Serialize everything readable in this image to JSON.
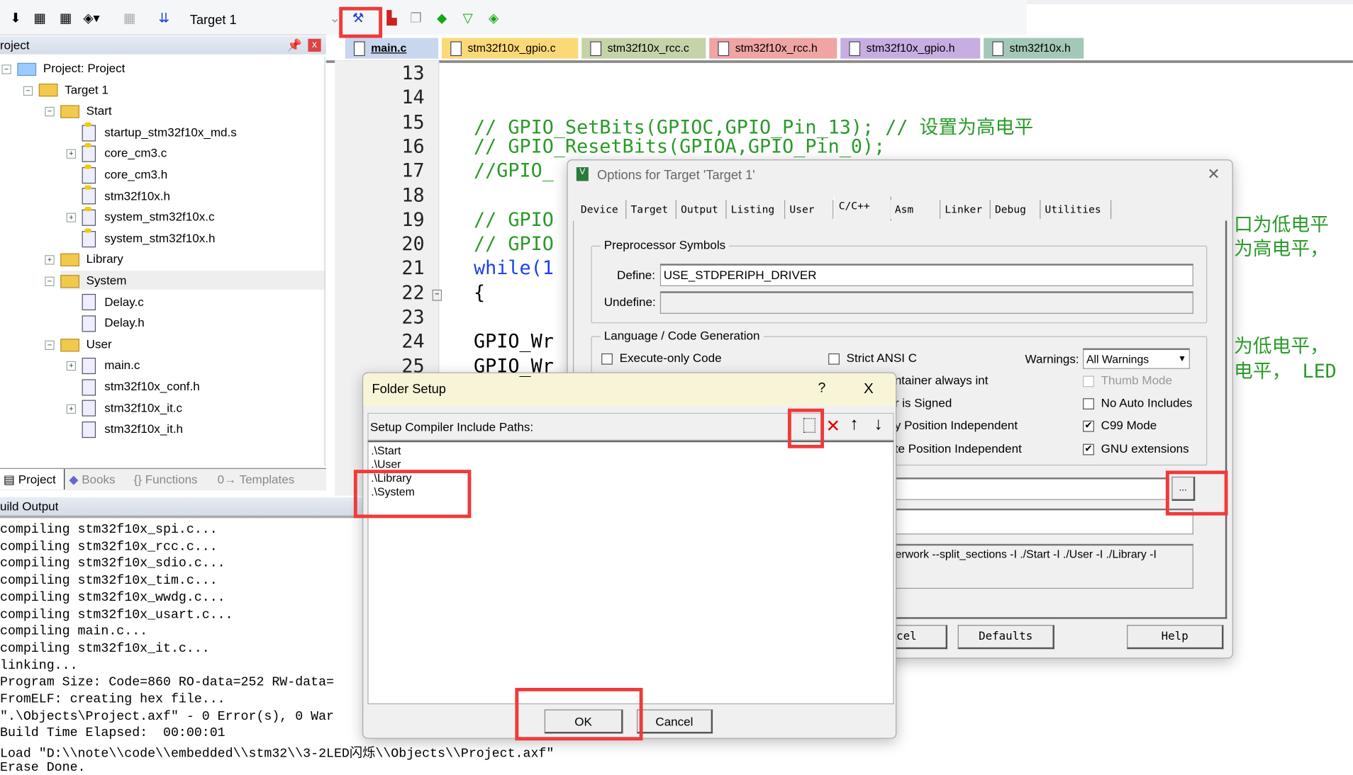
{
  "toolbar": {
    "target": "Target 1",
    "icons": [
      "translate-icon",
      "build-icon",
      "rebuild-icon",
      "batch-build-icon",
      "stop-build-icon",
      "download-icon",
      "target-options-icon",
      "file-extensions-icon",
      "manage-multi-project-icon",
      "select-packs-icon",
      "manage-run-time-icon",
      "pack-installer-icon"
    ]
  },
  "project_panel": {
    "title": "roject",
    "tree": [
      {
        "label": "Project: Project",
        "level": 0,
        "icon": "project-icon",
        "expander": "-"
      },
      {
        "label": "Target 1",
        "level": 1,
        "icon": "target-folder-icon",
        "expander": "-"
      },
      {
        "label": "Start",
        "level": 2,
        "icon": "folder-open-icon",
        "expander": "-"
      },
      {
        "label": "startup_stm32f10x_md.s",
        "level": 3,
        "icon": "key-file-icon",
        "expander": ""
      },
      {
        "label": "core_cm3.c",
        "level": 3,
        "icon": "key-file-icon",
        "expander": "+"
      },
      {
        "label": "core_cm3.h",
        "level": 3,
        "icon": "key-file-icon",
        "expander": ""
      },
      {
        "label": "stm32f10x.h",
        "level": 3,
        "icon": "key-file-icon",
        "expander": ""
      },
      {
        "label": "system_stm32f10x.c",
        "level": 3,
        "icon": "key-file-icon",
        "expander": "+"
      },
      {
        "label": "system_stm32f10x.h",
        "level": 3,
        "icon": "key-file-icon",
        "expander": ""
      },
      {
        "label": "Library",
        "level": 2,
        "icon": "folder-icon",
        "expander": "+"
      },
      {
        "label": "System",
        "level": 2,
        "icon": "folder-open-icon",
        "expander": "-",
        "selected": true
      },
      {
        "label": "Delay.c",
        "level": 3,
        "icon": "file-icon",
        "expander": ""
      },
      {
        "label": "Delay.h",
        "level": 3,
        "icon": "file-icon",
        "expander": ""
      },
      {
        "label": "User",
        "level": 2,
        "icon": "folder-open-icon",
        "expander": "-"
      },
      {
        "label": "main.c",
        "level": 3,
        "icon": "file-icon",
        "expander": "+"
      },
      {
        "label": "stm32f10x_conf.h",
        "level": 3,
        "icon": "file-icon",
        "expander": ""
      },
      {
        "label": "stm32f10x_it.c",
        "level": 3,
        "icon": "file-icon",
        "expander": "+"
      },
      {
        "label": "stm32f10x_it.h",
        "level": 3,
        "icon": "file-icon",
        "expander": ""
      }
    ],
    "tabs": [
      "Project",
      "Books",
      "{} Functions",
      "0→ Templates"
    ]
  },
  "editor": {
    "tabs": [
      {
        "label": "main.c",
        "color": "#c9d7ee",
        "active": true
      },
      {
        "label": "stm32f10x_gpio.c",
        "color": "#fcd977"
      },
      {
        "label": "stm32f10x_rcc.c",
        "color": "#c5d3a8"
      },
      {
        "label": "stm32f10x_rcc.h",
        "color": "#f0a4a4"
      },
      {
        "label": "stm32f10x_gpio.h",
        "color": "#c6aee3"
      },
      {
        "label": "stm32f10x.h",
        "color": "#a4c8b8"
      }
    ],
    "lines": [
      {
        "n": "13",
        "text": "",
        "cls": ""
      },
      {
        "n": "14",
        "text": "",
        "cls": ""
      },
      {
        "n": "15",
        "text": "// GPIO_SetBits(GPIOC,GPIO_Pin_13); // 设置为高电平",
        "cls": "cm"
      },
      {
        "n": "16",
        "text": "// GPIO_ResetBits(GPIOA,GPIO_Pin_0);",
        "cls": "cm"
      },
      {
        "n": "17",
        "text": "//GPIO_",
        "cls": "cm"
      },
      {
        "n": "18",
        "text": "",
        "cls": ""
      },
      {
        "n": "19",
        "text": "// GPIO",
        "cls": "cm",
        "tail": "口为低电平"
      },
      {
        "n": "20",
        "text": "// GPIO",
        "cls": "cm",
        "tail": "为高电平，"
      },
      {
        "n": "21",
        "text": "while(1",
        "cls": "kw"
      },
      {
        "n": "22",
        "text": "{",
        "cls": ""
      },
      {
        "n": "23",
        "text": "",
        "cls": ""
      },
      {
        "n": "24",
        "text": "GPIO_Wr",
        "cls": "",
        "tail": "为低电平，"
      },
      {
        "n": "25",
        "text": "GPIO_Wr",
        "cls": "",
        "tail": "电平， LED"
      }
    ]
  },
  "build_output": {
    "title": "uild Output",
    "lines": [
      "compiling stm32f10x_spi.c...",
      "compiling stm32f10x_rcc.c...",
      "compiling stm32f10x_sdio.c...",
      "compiling stm32f10x_tim.c...",
      "compiling stm32f10x_wwdg.c...",
      "compiling stm32f10x_usart.c...",
      "compiling main.c...",
      "compiling stm32f10x_it.c...",
      "linking...",
      "Program Size: Code=860 RO-data=252 RW-data=",
      "FromELF: creating hex file...",
      "\".\\Objects\\Project.axf\" - 0 Error(s), 0 War",
      "Build Time Elapsed:  00:00:01",
      "Load \"D:\\\\note\\\\code\\\\embedded\\\\stm32\\\\3-2LED闪烁\\\\Objects\\\\Project.axf\"",
      "Erase Done."
    ]
  },
  "options_dialog": {
    "title": "Options for Target 'Target 1'",
    "tabs": [
      "Device",
      "Target",
      "Output",
      "Listing",
      "User",
      "C/C++",
      "Asm",
      "Linker",
      "Debug",
      "Utilities"
    ],
    "active_tab": "C/C++",
    "preproc_label": "Preprocessor Symbols",
    "define_label": "Define:",
    "define_value": "USE_STDPERIPH_DRIVER",
    "undefine_label": "Undefine:",
    "undefine_value": "",
    "lang_label": "Language / Code Generation",
    "execute_only": "Execute-only Code",
    "strict_ansi": "Strict ANSI C",
    "warnings_label": "Warnings:",
    "warnings_value": "All Warnings",
    "enum_int": "ntainer always int",
    "char_signed": "r is Signed",
    "ro_pi": "y Position Independent",
    "rw_pi": "te Position Independent",
    "thumb_mode": "Thumb Mode",
    "no_auto_includes": "No Auto Includes",
    "c99_mode": "C99 Mode",
    "gnu_ext": "GNU extensions",
    "c99_checked": true,
    "gnu_checked": true,
    "browse_label": "...",
    "compiler_string": "terwork --split_sections -I ./Start -I ./User -I ./Library -I",
    "cancel_label": "ncel",
    "defaults_label": "Defaults",
    "help_label": "Help"
  },
  "folder_dialog": {
    "title": "Folder Setup",
    "help": "?",
    "close": "X",
    "label": "Setup Compiler Include Paths:",
    "paths": [
      ".\\Start",
      ".\\User",
      ".\\Library",
      ".\\System"
    ],
    "ok": "OK",
    "cancel": "Cancel"
  },
  "highlight_color": "#f03a3a"
}
